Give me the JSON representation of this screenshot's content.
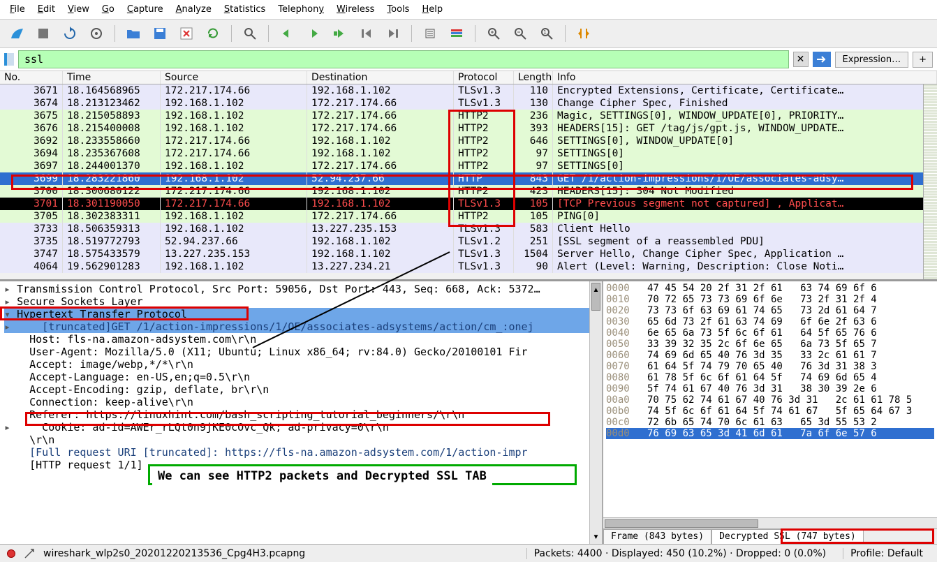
{
  "menu": {
    "file": "File",
    "edit": "Edit",
    "view": "View",
    "go": "Go",
    "capture": "Capture",
    "analyze": "Analyze",
    "statistics": "Statistics",
    "telephony": "Telephony",
    "wireless": "Wireless",
    "tools": "Tools",
    "help": "Help"
  },
  "filter": {
    "value": "ssl",
    "expression": "Expression…",
    "plus": "+"
  },
  "columns": {
    "no": "No.",
    "time": "Time",
    "src": "Source",
    "dst": "Destination",
    "proto": "Protocol",
    "len": "Length",
    "info": "Info"
  },
  "packets": [
    {
      "no": "3671",
      "time": "18.164568965",
      "src": "172.217.174.66",
      "dst": "192.168.1.102",
      "proto": "TLSv1.3",
      "len": "110",
      "info": "Encrypted Extensions, Certificate, Certificate…",
      "cls": "bg-lav"
    },
    {
      "no": "3674",
      "time": "18.213123462",
      "src": "192.168.1.102",
      "dst": "172.217.174.66",
      "proto": "TLSv1.3",
      "len": "130",
      "info": "Change Cipher Spec, Finished",
      "cls": "bg-lav"
    },
    {
      "no": "3675",
      "time": "18.215058893",
      "src": "192.168.1.102",
      "dst": "172.217.174.66",
      "proto": "HTTP2",
      "len": "236",
      "info": "Magic, SETTINGS[0], WINDOW_UPDATE[0], PRIORITY…",
      "cls": "bg-grn"
    },
    {
      "no": "3676",
      "time": "18.215400008",
      "src": "192.168.1.102",
      "dst": "172.217.174.66",
      "proto": "HTTP2",
      "len": "393",
      "info": "HEADERS[15]: GET /tag/js/gpt.js, WINDOW_UPDATE…",
      "cls": "bg-grn"
    },
    {
      "no": "3692",
      "time": "18.233558660",
      "src": "172.217.174.66",
      "dst": "192.168.1.102",
      "proto": "HTTP2",
      "len": "646",
      "info": "SETTINGS[0], WINDOW_UPDATE[0]",
      "cls": "bg-grn"
    },
    {
      "no": "3694",
      "time": "18.235367608",
      "src": "172.217.174.66",
      "dst": "192.168.1.102",
      "proto": "HTTP2",
      "len": "97",
      "info": "SETTINGS[0]",
      "cls": "bg-grn"
    },
    {
      "no": "3697",
      "time": "18.244001370",
      "src": "192.168.1.102",
      "dst": "172.217.174.66",
      "proto": "HTTP2",
      "len": "97",
      "info": "SETTINGS[0]",
      "cls": "bg-grn"
    },
    {
      "no": "3699",
      "time": "18.283221860",
      "src": "192.168.1.102",
      "dst": "52.94.237.66",
      "proto": "HTTP",
      "len": "843",
      "info": "GET /1/action-impressions/1/OE/associates-adsy…",
      "cls": "bg-sel"
    },
    {
      "no": "3700",
      "time": "18.300680122",
      "src": "172.217.174.66",
      "dst": "192.168.1.102",
      "proto": "HTTP2",
      "len": "423",
      "info": "HEADERS[15]: 304 Not Modified",
      "cls": "bg-grn"
    },
    {
      "no": "3701",
      "time": "18.301190050",
      "src": "172.217.174.66",
      "dst": "192.168.1.102",
      "proto": "TLSv1.3",
      "len": "105",
      "info": "[TCP Previous segment not captured] , Applicat…",
      "cls": "bg-blk"
    },
    {
      "no": "3705",
      "time": "18.302383311",
      "src": "192.168.1.102",
      "dst": "172.217.174.66",
      "proto": "HTTP2",
      "len": "105",
      "info": "PING[0]",
      "cls": "bg-grn"
    },
    {
      "no": "3733",
      "time": "18.506359313",
      "src": "192.168.1.102",
      "dst": "13.227.235.153",
      "proto": "TLSv1.3",
      "len": "583",
      "info": "Client Hello",
      "cls": "bg-lav"
    },
    {
      "no": "3735",
      "time": "18.519772793",
      "src": "52.94.237.66",
      "dst": "192.168.1.102",
      "proto": "TLSv1.2",
      "len": "251",
      "info": "[SSL segment of a reassembled PDU]",
      "cls": "bg-lav"
    },
    {
      "no": "3747",
      "time": "18.575433579",
      "src": "13.227.235.153",
      "dst": "192.168.1.102",
      "proto": "TLSv1.3",
      "len": "1504",
      "info": "Server Hello, Change Cipher Spec, Application …",
      "cls": "bg-lav"
    },
    {
      "no": "4064",
      "time": "19.562901283",
      "src": "192.168.1.102",
      "dst": "13.227.234.21",
      "proto": "TLSv1.3",
      "len": "90",
      "info": "Alert (Level: Warning, Description: Close Noti…",
      "cls": "bg-lav"
    }
  ],
  "details": {
    "l0": "Transmission Control Protocol, Src Port: 59056, Dst Port: 443, Seq: 668, Ack: 5372…",
    "l1": "Secure Sockets Layer",
    "l2": "Hypertext Transfer Protocol",
    "l3": "    [truncated]GET /1/action-impressions/1/OE/associates-adsystems/action/cm_:onej",
    "l4": "    Host: fls-na.amazon-adsystem.com\\r\\n",
    "l5": "    User-Agent: Mozilla/5.0 (X11; Ubuntu; Linux x86_64; rv:84.0) Gecko/20100101 Fir",
    "l6": "    Accept: image/webp,*/*\\r\\n",
    "l7": "    Accept-Language: en-US,en;q=0.5\\r\\n",
    "l8": "    Accept-Encoding: gzip, deflate, br\\r\\n",
    "l9": "    Connection: keep-alive\\r\\n",
    "l10": "    Referer: https://linuxhint.com/bash_scripting_tutorial_beginners/\\r\\n",
    "l11": "    Cookie: ad-id=AWEr_rLQt0n9jKE0cOvc_Qk; ad-privacy=0\\r\\n",
    "l12": "    \\r\\n",
    "l13": "    [Full request URI [truncated]: https://fls-na.amazon-adsystem.com/1/action-impr",
    "l14": "    [HTTP request 1/1]"
  },
  "hex": [
    {
      "off": "0000",
      "b": "47 45 54 20 2f 31 2f 61",
      "a": "63 74 69 6f 6"
    },
    {
      "off": "0010",
      "b": "70 72 65 73 73 69 6f 6e",
      "a": "73 2f 31 2f 4"
    },
    {
      "off": "0020",
      "b": "73 73 6f 63 69 61 74 65",
      "a": "73 2d 61 64 7"
    },
    {
      "off": "0030",
      "b": "65 6d 73 2f 61 63 74 69",
      "a": "6f 6e 2f 63 6"
    },
    {
      "off": "0040",
      "b": "6e 65 6a 73 5f 6c 6f 61",
      "a": "64 5f 65 76 6"
    },
    {
      "off": "0050",
      "b": "33 39 32 35 2c 6f 6e 65",
      "a": "6a 73 5f 65 7"
    },
    {
      "off": "0060",
      "b": "74 69 6d 65 40 76 3d 35",
      "a": "33 2c 61 61 7"
    },
    {
      "off": "0070",
      "b": "61 64 5f 74 79 70 65 40",
      "a": "76 3d 31 38 3"
    },
    {
      "off": "0080",
      "b": "61 78 5f 6c 6f 61 64 5f",
      "a": "74 69 6d 65 4"
    },
    {
      "off": "0090",
      "b": "5f 74 61 67 40 76 3d 31",
      "a": "38 30 39 2e 6"
    },
    {
      "off": "00a0",
      "b": "70 75 62 74 61 67 40 76 3d 31",
      "a": "2c 61 61 78 5"
    },
    {
      "off": "00b0",
      "b": "74 5f 6c 6f 61 64 5f 74 61 67",
      "a": "5f 65 64 67 3"
    },
    {
      "off": "00c0",
      "b": "72 6b 65 74 70 6c 61 63",
      "a": "65 3d 55 53 2"
    },
    {
      "off": "00d0",
      "b": "76 69 63 65 3d 41 6d 61",
      "a": "7a 6f 6e 57 6",
      "sel": true
    }
  ],
  "tabs": {
    "frame": "Frame (843 bytes)",
    "ssl": "Decrypted SSL (747 bytes)"
  },
  "status": {
    "file": "wireshark_wlp2s0_20201220213536_Cpg4H3.pcapng",
    "packets": "Packets: 4400 · Displayed: 450 (10.2%) · Dropped: 0 (0.0%)",
    "profile": "Profile: Default"
  },
  "annotation": "We can see HTTP2 packets and Decrypted SSL TAB"
}
